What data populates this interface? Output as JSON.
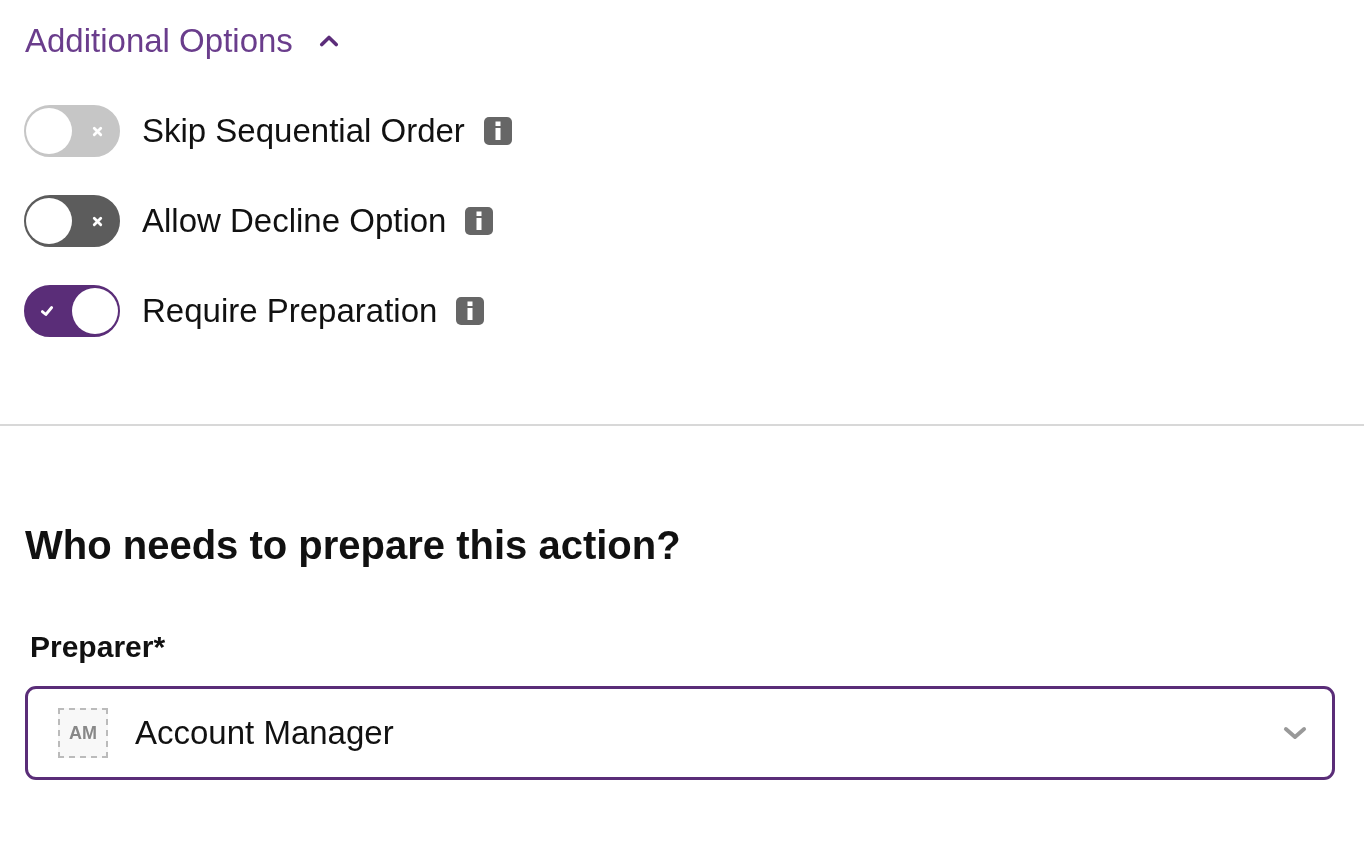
{
  "options_section": {
    "title": "Additional Options",
    "expanded": true,
    "toggles": [
      {
        "label": "Skip Sequential Order",
        "on": false,
        "disabled": true
      },
      {
        "label": "Allow Decline Option",
        "on": false,
        "disabled": false
      },
      {
        "label": "Require Preparation",
        "on": true,
        "disabled": false
      }
    ]
  },
  "prepare_section": {
    "heading": "Who needs to prepare this action?",
    "field_label": "Preparer*",
    "select": {
      "avatar": "AM",
      "value": "Account Manager"
    }
  }
}
